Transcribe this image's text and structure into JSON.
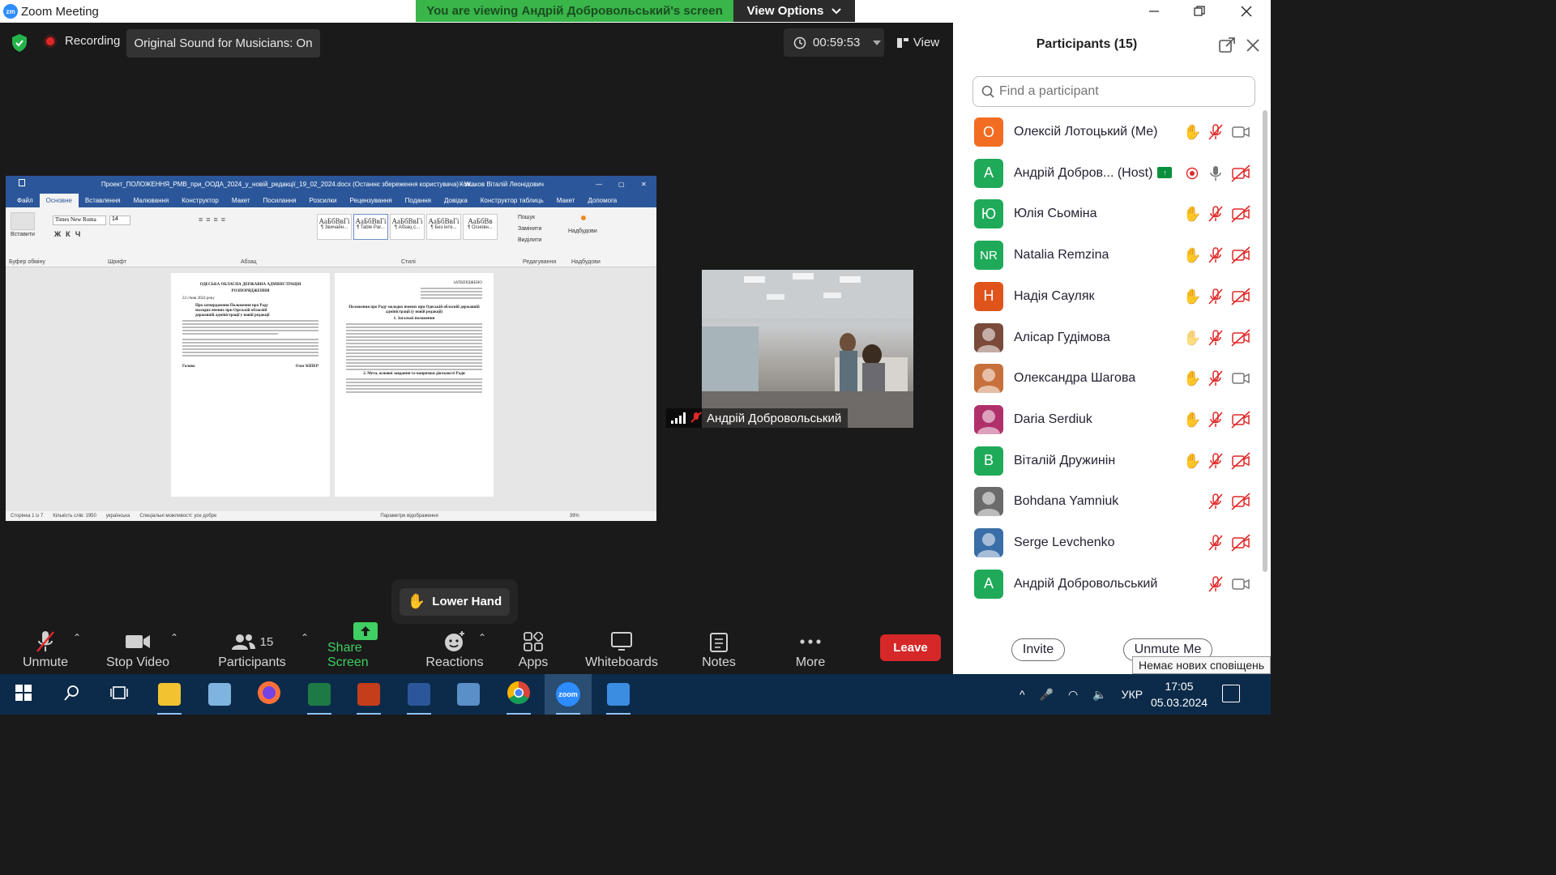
{
  "window": {
    "logo": "zm",
    "title": "Zoom Meeting",
    "minimize_icon": "minimize-icon",
    "restore_icon": "restore-icon",
    "close_icon": "close-icon"
  },
  "banner": {
    "viewing_text": "You are viewing Андрій Добровольський's screen",
    "view_options_label": "View Options",
    "color": "#39b54a"
  },
  "meeting_bar": {
    "recording_label": "Recording",
    "original_sound_label": "Original Sound for Musicians: On",
    "timer": "00:59:53",
    "view_label": "View"
  },
  "shared_screen": {
    "word": {
      "title": "Проект_ПОЛОЖЕННЯ_РМВ_при_ООДА_2024_у_новій_редакції_19_02_2024.docx (Останнє збереження користувача) - W...",
      "user": "Кожаков Віталій Леонідович",
      "tabs": [
        "Файл",
        "Основне",
        "Вставлення",
        "Малювання",
        "Конструктор",
        "Макет",
        "Посилання",
        "Розсилки",
        "Рецензування",
        "Подання",
        "Довідка",
        "Конструктор таблиць",
        "Макет"
      ],
      "active_tab": "Основне",
      "help_label": "Допомога",
      "paste_label": "Вставити",
      "font_name": "Times New Roma",
      "font_size": "14",
      "groups": [
        "Буфер обміну",
        "Шрифт",
        "Абзац",
        "Стилі",
        "Редагування",
        "Надбудови"
      ],
      "styles": [
        {
          "sample": "АаБбВвГі",
          "name": "¶ Звичайн..."
        },
        {
          "sample": "АаБбВвГі",
          "name": "¶ Table Par..."
        },
        {
          "sample": "АаБбВвГі",
          "name": "¶ Абзац с..."
        },
        {
          "sample": "АаБбВвГі",
          "name": "¶ Без інте..."
        },
        {
          "sample": "АаБбВв",
          "name": "¶ Основн..."
        }
      ],
      "editing": [
        "Пошук",
        "Замінити",
        "Виділити"
      ],
      "addins_label": "Надбудови",
      "page1_heading": "ОДЕСЬКА ОБЛАСНА ДЕРЖАВНА АДМІНІСТРАЦІЯ",
      "page1_sub": "РОЗПОРЯДЖЕННЯ",
      "page1_date": "22 січня 2024 року",
      "page1_subject": "Про затвердження Положення про Раду молодих вчених при Одеській обласній державній адміністрації у новій редакції",
      "page1_head": "Голова",
      "page1_sign": "Олег КІПЕР",
      "page2_approved": "ЗАТВЕРДЖЕНО",
      "page2_title": "Положення про Раду молодих вчених при Одеській обласній державній адміністрації (у новій редакції)",
      "page2_section1": "1. Загальні положення",
      "page2_section2": "2. Мета, основні завдання та напрямки діяльності Ради",
      "status_page": "Сторінка 1 із 7",
      "status_words": "Кількість слів: 1950",
      "status_lang": "українська",
      "status_access": "Спеціальні можливості: усе добре",
      "status_display": "Параметри відображення",
      "zoom": "39%"
    }
  },
  "video_tile": {
    "name": "Андрій Добровольський"
  },
  "lower_hand": {
    "label": "Lower Hand"
  },
  "toolbar": {
    "unmute_label": "Unmute",
    "stop_video_label": "Stop Video",
    "participants_label": "Participants",
    "participants_count": "15",
    "share_screen_label": "Share Screen",
    "reactions_label": "Reactions",
    "apps_label": "Apps",
    "whiteboards_label": "Whiteboards",
    "notes_label": "Notes",
    "more_label": "More",
    "leave_label": "Leave",
    "share_color": "#3fcf62",
    "leave_color": "#d62828"
  },
  "participants_panel": {
    "title": "Participants (15)",
    "search_placeholder": "Find a participant",
    "invite_label": "Invite",
    "unmute_me_label": "Unmute Me",
    "participants": [
      {
        "initials": "О",
        "color": "#f26d21",
        "name": "Олексій Лотоцький (Me)",
        "hand": "raised",
        "mic": "muted",
        "cam": "on"
      },
      {
        "initials": "А",
        "color": "#1faa59",
        "name": "Андрій Добров... (Host)",
        "host_badge": true,
        "hand": "recording",
        "mic": "on",
        "cam": "off"
      },
      {
        "initials": "Ю",
        "color": "#1faa59",
        "name": "Юлія Сьоміна",
        "hand": "raised",
        "mic": "muted",
        "cam": "off"
      },
      {
        "initials": "NR",
        "color": "#1faa59",
        "name": "Natalia Remzina",
        "hand": "raised",
        "mic": "muted",
        "cam": "off"
      },
      {
        "initials": "Н",
        "color": "#e0531b",
        "name": "Надія Сауляк",
        "hand": "raised",
        "mic": "muted",
        "cam": "off"
      },
      {
        "initials": "",
        "color": "#7a4a3a",
        "name": "Алісар  Гудімова",
        "hand": "raised-light",
        "mic": "muted",
        "cam": "off"
      },
      {
        "initials": "",
        "color": "#c8703c",
        "name": "Олександра Шагова",
        "hand": "raised",
        "mic": "muted",
        "cam": "on"
      },
      {
        "initials": "",
        "color": "#b0306a",
        "name": "Daria Serdiuk",
        "hand": "raised",
        "mic": "muted",
        "cam": "off"
      },
      {
        "initials": "В",
        "color": "#1faa59",
        "name": "Віталій Дружинін",
        "hand": "raised",
        "mic": "muted",
        "cam": "off"
      },
      {
        "initials": "",
        "color": "#6b6b6b",
        "name": "Bohdana Yamniuk",
        "hand": "none",
        "mic": "muted",
        "cam": "off"
      },
      {
        "initials": "",
        "color": "#3a6ea8",
        "name": "Serge Levchenko",
        "hand": "none",
        "mic": "muted",
        "cam": "off"
      },
      {
        "initials": "А",
        "color": "#1faa59",
        "name": "Андрій Добровольський",
        "hand": "none",
        "mic": "muted",
        "cam": "on"
      }
    ]
  },
  "tooltip": {
    "text": "Немає нових сповіщень"
  },
  "taskbar": {
    "apps": [
      "start-icon",
      "search-icon",
      "task-view-icon",
      "file-explorer-icon",
      "paint-icon",
      "firefox-icon",
      "excel-icon",
      "powerpoint-icon",
      "word-icon",
      "calculator-icon",
      "chrome-icon",
      "zoom-icon",
      "photos-icon"
    ],
    "zoom_logo": "zoom",
    "language": "УКР",
    "time": "17:05",
    "date": "05.03.2024"
  }
}
